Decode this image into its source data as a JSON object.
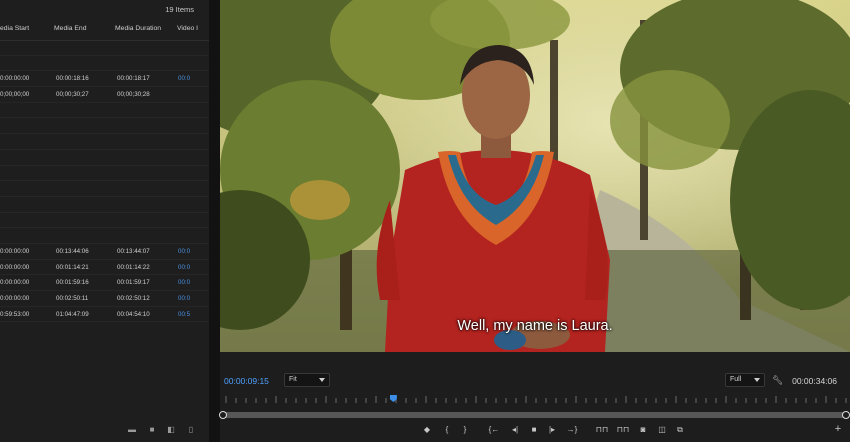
{
  "project": {
    "items_count": "19 Items",
    "columns": [
      "edia Start",
      "Media End",
      "Media Duration",
      "Video I"
    ],
    "rows": [
      {
        "start": "",
        "end": "",
        "duration": "",
        "video": ""
      },
      {
        "start": "",
        "end": "",
        "duration": "",
        "video": ""
      },
      {
        "start": "0:00:00:00",
        "end": "00:00:18:16",
        "duration": "00:00:18:17",
        "video": "00:0"
      },
      {
        "start": "0;00;00;00",
        "end": "00;00;30;27",
        "duration": "00;00;30;28",
        "video": ""
      },
      {
        "start": "",
        "end": "",
        "duration": "",
        "video": ""
      },
      {
        "start": "",
        "end": "",
        "duration": "",
        "video": ""
      },
      {
        "start": "",
        "end": "",
        "duration": "",
        "video": ""
      },
      {
        "start": "",
        "end": "",
        "duration": "",
        "video": ""
      },
      {
        "start": "",
        "end": "",
        "duration": "",
        "video": ""
      },
      {
        "start": "",
        "end": "",
        "duration": "",
        "video": ""
      },
      {
        "start": "",
        "end": "",
        "duration": "",
        "video": ""
      },
      {
        "start": "",
        "end": "",
        "duration": "",
        "video": ""
      },
      {
        "start": "",
        "end": "",
        "duration": "",
        "video": ""
      },
      {
        "start": "0:00:00:00",
        "end": "00:13:44:06",
        "duration": "00:13:44:07",
        "video": "00:0"
      },
      {
        "start": "0:00:00:00",
        "end": "00:01:14:21",
        "duration": "00:01:14:22",
        "video": "00:0"
      },
      {
        "start": "0:00:00:00",
        "end": "00:01:59:16",
        "duration": "00:01:59:17",
        "video": "00:0"
      },
      {
        "start": "0:00:00:00",
        "end": "00:02:50:11",
        "duration": "00:02:50:12",
        "video": "00:0"
      },
      {
        "start": "0:59:53:00",
        "end": "01:04:47:09",
        "duration": "00:04:54:10",
        "video": "00:5"
      }
    ]
  },
  "monitor": {
    "subtitle": "Well, my name is Laura.",
    "current_timecode": "00:00:09:15",
    "duration_timecode": "00:00:34:06",
    "zoom": "Fit",
    "resolution": "Full",
    "playhead_progress": 0.27
  },
  "icons": {
    "project_toolbar": [
      "folder-icon",
      "new-bin-icon",
      "new-item-icon",
      "trash-icon"
    ],
    "transport": [
      "marker-icon",
      "mark-in-icon",
      "mark-out-icon",
      "go-to-in-icon",
      "step-back-icon",
      "stop-icon",
      "step-forward-icon",
      "go-to-out-icon",
      "lift-icon",
      "extract-icon",
      "export-frame-icon",
      "comparison-view-icon",
      "proxy-toggle-icon",
      "add-button-icon"
    ]
  },
  "colors": {
    "accent_blue": "#4ea1ff",
    "panel_bg": "#1e1e1e"
  }
}
